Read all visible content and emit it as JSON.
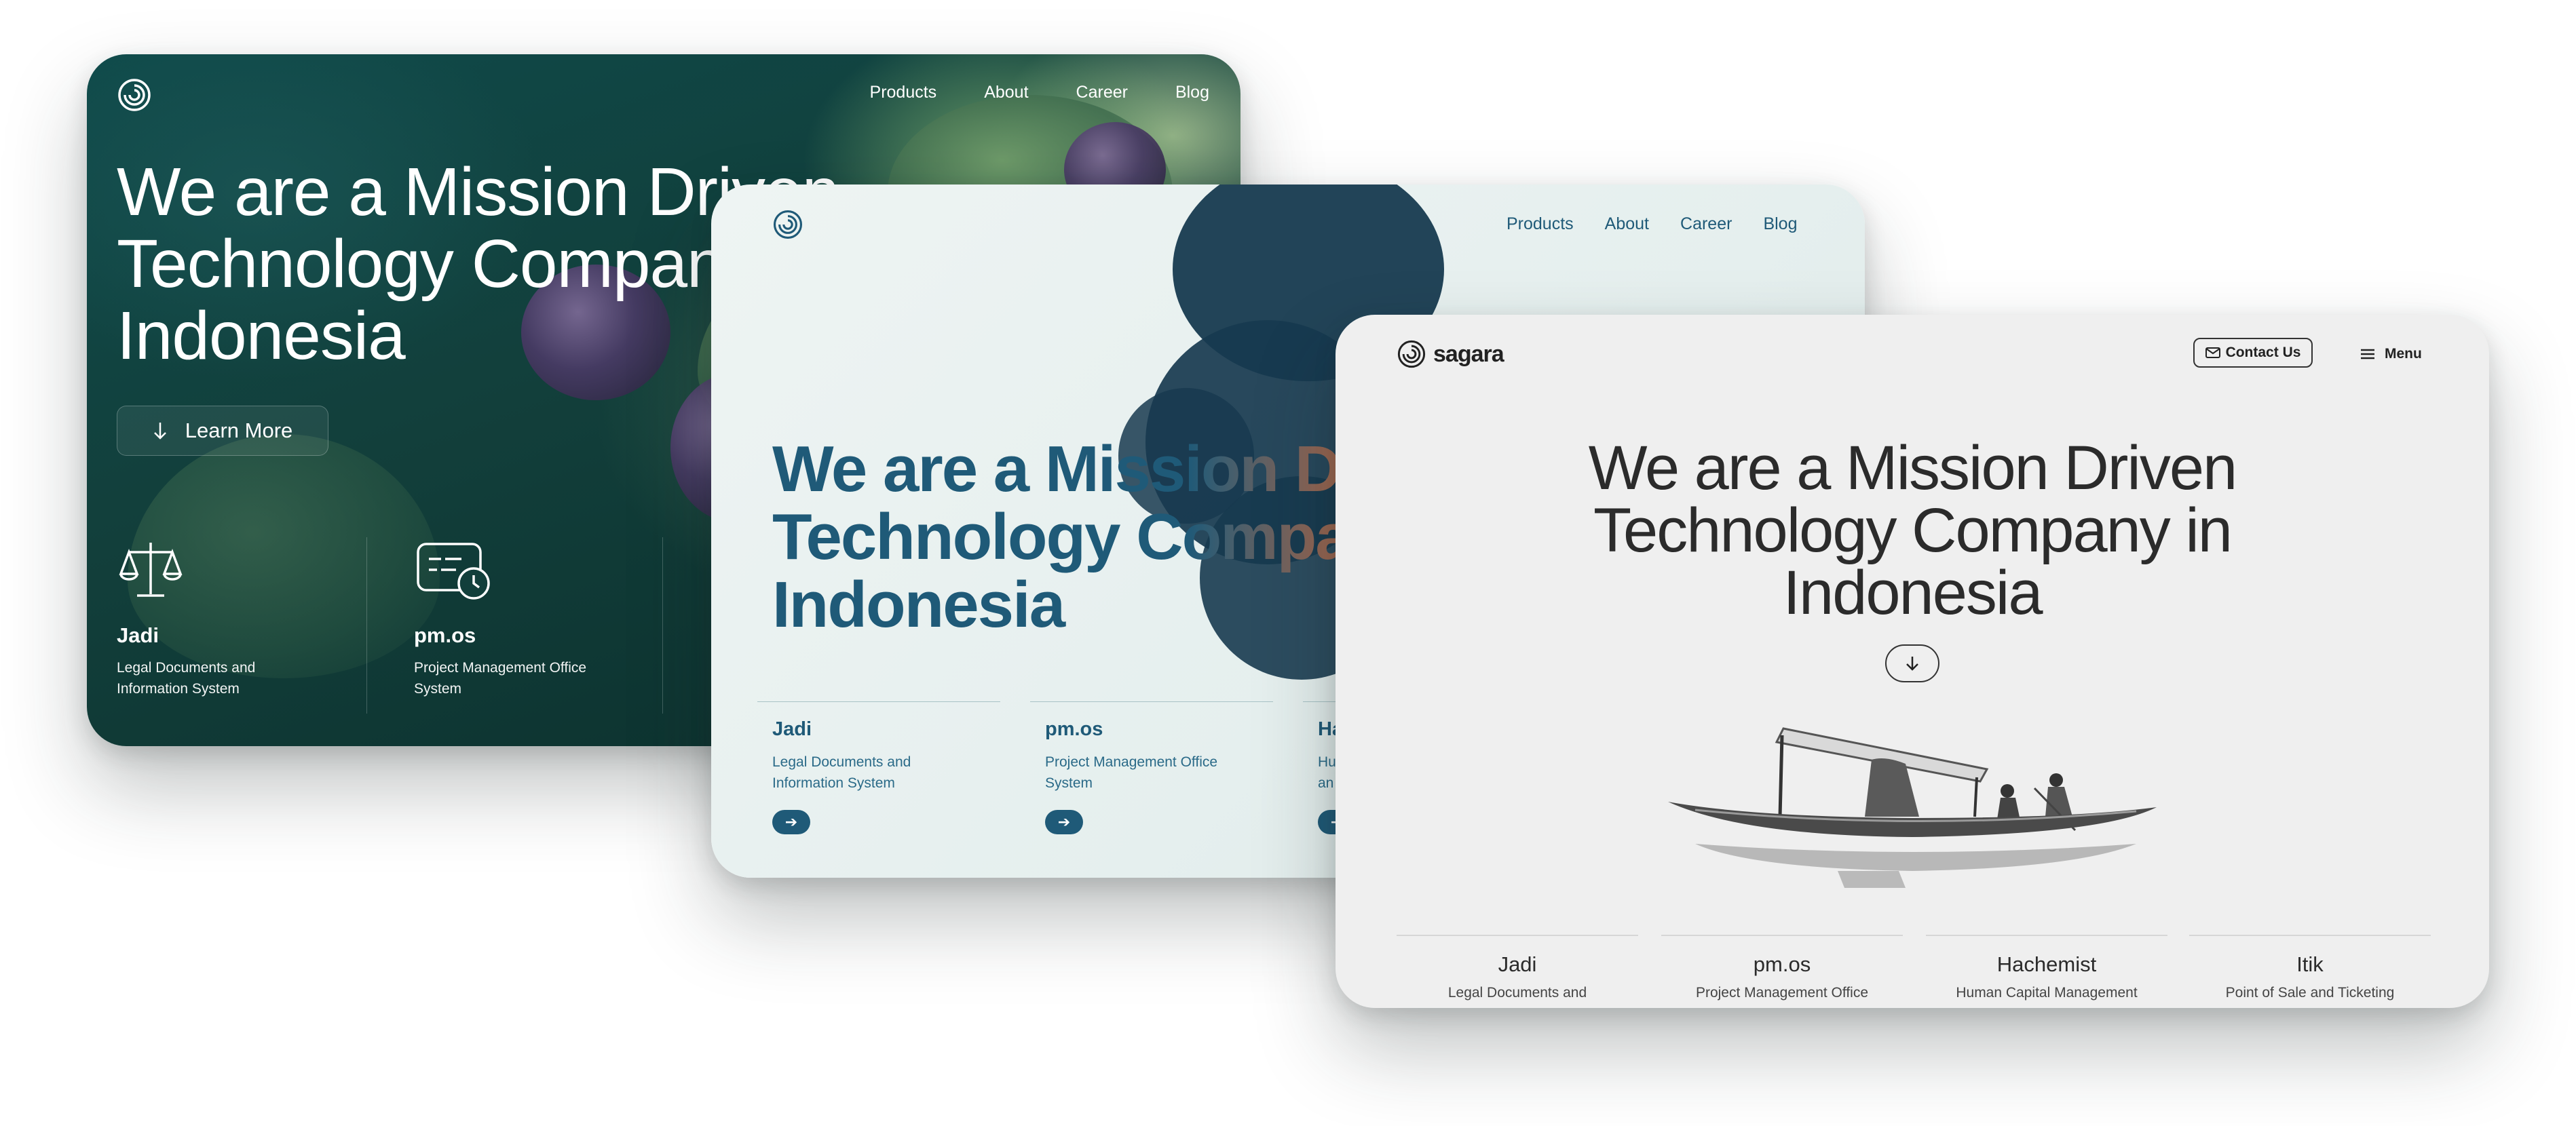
{
  "card_dark": {
    "nav": [
      "Products",
      "About",
      "Career",
      "Blog"
    ],
    "hero": "We are a Mission Driven\nTechnology Company\nIndonesia",
    "learn_more": "Learn More",
    "products": [
      {
        "name": "Jadi",
        "desc": "Legal Documents and\nInformation System"
      },
      {
        "name": "pm.os",
        "desc": "Project Management Office\nSystem"
      }
    ]
  },
  "card_teal": {
    "nav": [
      "Products",
      "About",
      "Career",
      "Blog"
    ],
    "hero": "We are a Mission Driven\nTechnology Company\nIndonesia",
    "products": [
      {
        "name": "Jadi",
        "desc": "Legal Documents and\nInformation System"
      },
      {
        "name": "pm.os",
        "desc": "Project Management Office\nSystem"
      },
      {
        "name": "Ha",
        "desc": "Hu\nan"
      }
    ]
  },
  "card_grey": {
    "brand": "sagara",
    "contact": "Contact Us",
    "menu": "Menu",
    "hero": "We are a Mission Driven\nTechnology Company in\nIndonesia",
    "products": [
      {
        "name": "Jadi",
        "desc": "Legal Documents and"
      },
      {
        "name": "pm.os",
        "desc": "Project Management Office"
      },
      {
        "name": "Hachemist",
        "desc": "Human Capital Management"
      },
      {
        "name": "Itik",
        "desc": "Point of Sale and Ticketing"
      }
    ]
  },
  "colors": {
    "teal_brand": "#1f5a78",
    "copper_accent": "#c06a45",
    "dark_green": "#123f3b",
    "grey_bg": "#efefef"
  },
  "icons": [
    "logo-icon",
    "arrow-down-icon",
    "scales-icon",
    "schedule-icon",
    "arrow-right-icon",
    "mail-icon",
    "menu-icon"
  ]
}
